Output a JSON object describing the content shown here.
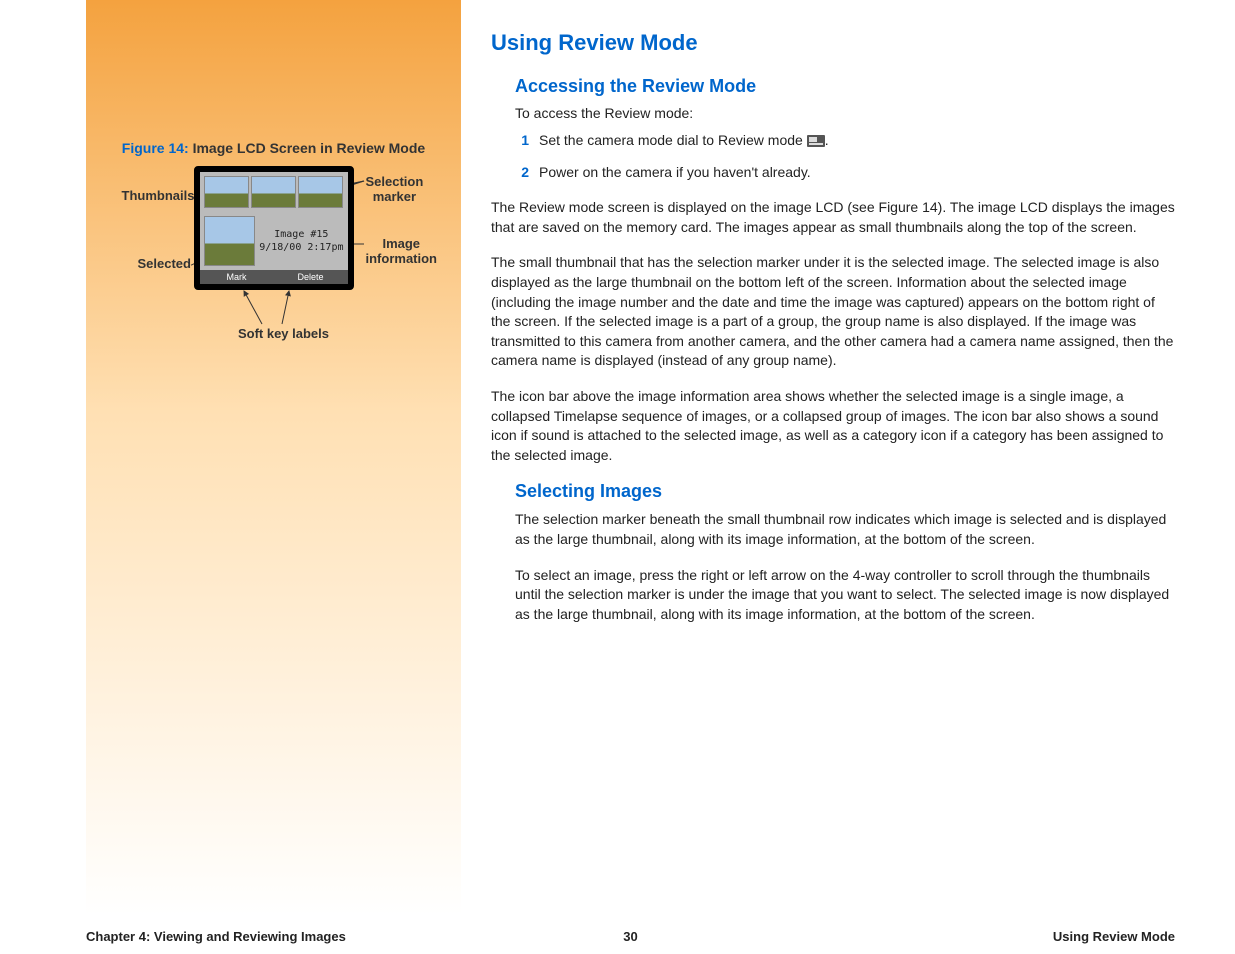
{
  "content": {
    "h1": "Using Review Mode",
    "section1": {
      "h2": "Accessing the Review Mode",
      "lead": "To access the Review mode:",
      "steps": [
        {
          "num": "1",
          "text_before": "Set the camera mode dial to Review mode ",
          "text_after": "."
        },
        {
          "num": "2",
          "text_before": "Power on the camera if you haven't already.",
          "text_after": ""
        }
      ],
      "para1": "The Review mode screen is displayed on the image LCD (see Figure 14). The image LCD displays the images that are saved on the memory card. The images appear as small thumbnails along the top of the screen.",
      "para2": "The small thumbnail that has the selection marker under it is the selected image. The selected image is also displayed as the large thumbnail on the bottom left of the screen. Information about the selected image (including the image number and the date and time the image was captured) appears on the bottom right of the screen. If the selected image is a part of a group, the group name is also displayed. If the image was transmitted to this camera from another camera, and the other camera had a camera name assigned, then the camera name is displayed (instead of any group name).",
      "para3": "The icon bar above the image information area shows whether the selected image is a single image, a collapsed Timelapse sequence of images, or a collapsed group of images. The icon bar also shows a sound icon if sound is attached to the selected image, as well as a category icon if a category has been assigned to the selected image."
    },
    "section2": {
      "h2": "Selecting Images",
      "para1": "The selection marker beneath the small thumbnail row indicates which image is selected and is displayed as the large thumbnail, along with its image information, at the bottom of the screen.",
      "para2": "To select an image, press the right or left arrow on the 4-way controller to scroll through the thumbnails until the selection marker is under the image that you want to select. The selected image is now displayed as the large thumbnail, along with its image information, at the bottom of the screen."
    }
  },
  "figure": {
    "num": "Figure 14:",
    "title": "Image LCD Screen in Review Mode",
    "lcd": {
      "image_info_line1": "Image #15",
      "image_info_line2": "9/18/00  2:17pm",
      "softkey_left": "Mark",
      "softkey_right": "Delete"
    },
    "annotations": {
      "thumbnails": "Thumbnails",
      "selected_image": "Selected image",
      "selection_marker": "Selection marker",
      "image_information": "Image information",
      "soft_key_labels": "Soft key labels"
    }
  },
  "footer": {
    "left": "Chapter 4: Viewing and Reviewing Images",
    "mid": "30",
    "right": "Using Review Mode"
  }
}
